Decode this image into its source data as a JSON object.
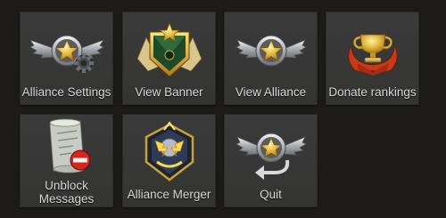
{
  "menu": {
    "items": [
      {
        "label": "Alliance Settings",
        "icon": "winged-star-gear-icon"
      },
      {
        "label": "View Banner",
        "icon": "alliance-banner-icon"
      },
      {
        "label": "View Alliance",
        "icon": "winged-star-icon"
      },
      {
        "label": "Donate rankings",
        "icon": "trophy-laurel-icon"
      },
      {
        "label": "Unblock\nMessages",
        "icon": "scroll-blocked-icon"
      },
      {
        "label": "Alliance Merger",
        "icon": "merge-emblem-icon"
      },
      {
        "label": "Quit",
        "icon": "winged-star-return-icon"
      }
    ]
  },
  "colors": {
    "background": "#1c1b19",
    "tile": "#383838",
    "label": "#d8d8d8",
    "gold": "#e2b73c",
    "block_red": "#d8261c"
  }
}
